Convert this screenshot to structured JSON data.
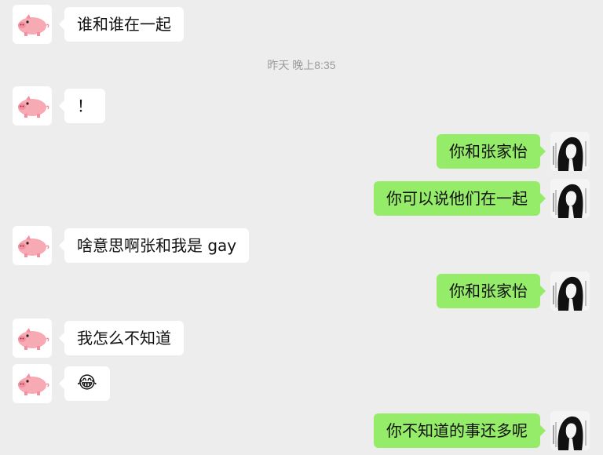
{
  "colors": {
    "background": "#ededed",
    "incoming_bubble": "#ffffff",
    "outgoing_bubble": "#95ec69",
    "timestamp_text": "#9a9a9a"
  },
  "icons": {
    "incoming_avatar": "pink-pig-avatar-icon",
    "outgoing_avatar": "sketch-portrait-avatar-icon"
  },
  "timestamp": "昨天 晚上8:35",
  "messages": [
    {
      "side": "left",
      "text": "谁和谁在一起"
    },
    {
      "side": "left",
      "text": "！"
    },
    {
      "side": "right",
      "text": "你和张家怡"
    },
    {
      "side": "right",
      "text": "你可以说他们在一起"
    },
    {
      "side": "left",
      "text": "啥意思啊张和我是 gay"
    },
    {
      "side": "right",
      "text": "你和张家怡"
    },
    {
      "side": "left",
      "text": "我怎么不知道"
    },
    {
      "side": "left",
      "text": "😂"
    },
    {
      "side": "right",
      "text": "你不知道的事还多呢"
    }
  ]
}
